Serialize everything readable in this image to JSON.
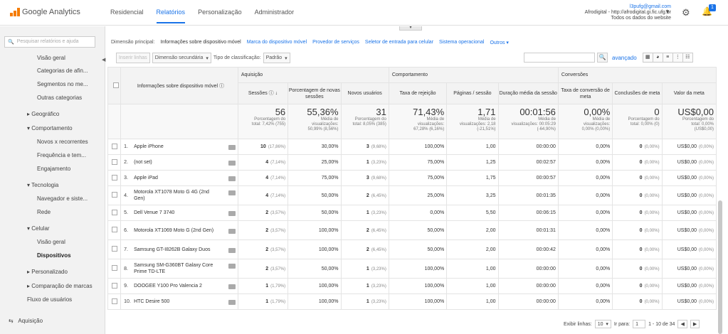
{
  "header": {
    "logo_text": "Google Analytics",
    "nav": [
      "Residencial",
      "Relatórios",
      "Personalização",
      "Administrador"
    ],
    "account_email": "l3pufg@gmail.com",
    "account_site": "Afrodigital - http://afrodigital.gi.fic.ufg.br",
    "account_view": "Todos os dados do website",
    "notification_count": "1"
  },
  "sidebar": {
    "search_placeholder": "Pesquisar relatórios e ajuda",
    "items": [
      "Visão geral",
      "Categorias de afin...",
      "Segmentos no me...",
      "Outras categorias",
      "Geográfico",
      "Comportamento",
      "Novos x recorrentes",
      "Frequência e tem...",
      "Engajamento",
      "Tecnologia",
      "Navegador e siste...",
      "Rede",
      "Celular",
      "Visão geral",
      "Dispositivos",
      "Personalizado",
      "Comparação de marcas",
      "Fluxo de usuários",
      "Aquisição"
    ]
  },
  "dimensions": {
    "label": "Dimensão principal:",
    "current": "Informações sobre dispositivo móvel",
    "links": [
      "Marca do dispositivo móvel",
      "Provedor de serviços",
      "Seletor de entrada para celular",
      "Sistema operacional",
      "Outros"
    ]
  },
  "controls": {
    "plot": "Inserir linhas",
    "secondary": "Dimensão secundária",
    "sort_label": "Tipo de classificação:",
    "sort_value": "Padrão",
    "advanced": "avançado"
  },
  "table": {
    "groups": [
      "Aquisição",
      "Comportamento",
      "Conversões"
    ],
    "dim_header": "Informações sobre dispositivo móvel",
    "columns": [
      "Sessões",
      "Porcentagem de novas sessões",
      "Novos usuários",
      "Taxa de rejeição",
      "Páginas / sessão",
      "Duração média da sessão",
      "Taxa de conversão de meta",
      "Conclusões de meta",
      "Valor da meta"
    ],
    "totals": [
      {
        "v": "56",
        "s1": "Porcentagem do",
        "s2": "total: 7,42% (755)",
        "s3": ""
      },
      {
        "v": "55,36%",
        "s1": "Média de",
        "s2": "visualizações:",
        "s3": "50,99% (8,56%)"
      },
      {
        "v": "31",
        "s1": "Porcentagem do",
        "s2": "total: 8,05% (385)",
        "s3": ""
      },
      {
        "v": "71,43%",
        "s1": "Média de",
        "s2": "visualizações:",
        "s3": "67,28% (6,16%)"
      },
      {
        "v": "1,71",
        "s1": "Média de",
        "s2": "visualizações: 2,18",
        "s3": "(-21,51%)"
      },
      {
        "v": "00:01:56",
        "s1": "Média de",
        "s2": "visualizações: 00:05:29",
        "s3": "(-64,90%)"
      },
      {
        "v": "0,00%",
        "s1": "Média de",
        "s2": "visualizações:",
        "s3": "0,00% (0,00%)"
      },
      {
        "v": "0",
        "s1": "Porcentagem do",
        "s2": "total: 0,00% (0)",
        "s3": ""
      },
      {
        "v": "US$0,00",
        "s1": "Porcentagem do",
        "s2": "total: 0,00%",
        "s3": "(US$0,00)"
      }
    ],
    "rows": [
      {
        "i": "1.",
        "name": "Apple iPhone",
        "s": "10",
        "sp": "(17,86%)",
        "ns": "30,00%",
        "nu": "3",
        "nup": "(9,68%)",
        "tr": "100,00%",
        "ps": "1,00",
        "d": "00:00:00",
        "tc": "0,00%",
        "cm": "0",
        "cmp": "(0,00%)",
        "vm": "US$0,00",
        "vmp": "(0,00%)"
      },
      {
        "i": "2.",
        "name": "(not set)",
        "s": "4",
        "sp": "(7,14%)",
        "ns": "25,00%",
        "nu": "1",
        "nup": "(3,23%)",
        "tr": "75,00%",
        "ps": "1,25",
        "d": "00:02:57",
        "tc": "0,00%",
        "cm": "0",
        "cmp": "(0,00%)",
        "vm": "US$0,00",
        "vmp": "(0,00%)"
      },
      {
        "i": "3.",
        "name": "Apple iPad",
        "s": "4",
        "sp": "(7,14%)",
        "ns": "75,00%",
        "nu": "3",
        "nup": "(9,68%)",
        "tr": "75,00%",
        "ps": "1,75",
        "d": "00:00:57",
        "tc": "0,00%",
        "cm": "0",
        "cmp": "(0,00%)",
        "vm": "US$0,00",
        "vmp": "(0,00%)"
      },
      {
        "i": "4.",
        "name": "Motorola XT1078 Moto G 4G (2nd Gen)",
        "s": "4",
        "sp": "(7,14%)",
        "ns": "50,00%",
        "nu": "2",
        "nup": "(6,45%)",
        "tr": "25,00%",
        "ps": "3,25",
        "d": "00:01:35",
        "tc": "0,00%",
        "cm": "0",
        "cmp": "(0,00%)",
        "vm": "US$0,00",
        "vmp": "(0,00%)"
      },
      {
        "i": "5.",
        "name": "Dell Venue 7 3740",
        "s": "2",
        "sp": "(3,57%)",
        "ns": "50,00%",
        "nu": "1",
        "nup": "(3,23%)",
        "tr": "0,00%",
        "ps": "5,50",
        "d": "00:06:15",
        "tc": "0,00%",
        "cm": "0",
        "cmp": "(0,00%)",
        "vm": "US$0,00",
        "vmp": "(0,00%)"
      },
      {
        "i": "6.",
        "name": "Motorola XT1069 Moto G (2nd Gen)",
        "s": "2",
        "sp": "(3,57%)",
        "ns": "100,00%",
        "nu": "2",
        "nup": "(6,45%)",
        "tr": "50,00%",
        "ps": "2,00",
        "d": "00:01:31",
        "tc": "0,00%",
        "cm": "0",
        "cmp": "(0,00%)",
        "vm": "US$0,00",
        "vmp": "(0,00%)"
      },
      {
        "i": "7.",
        "name": "Samsung GT-I8262B Galaxy Duos",
        "s": "2",
        "sp": "(3,57%)",
        "ns": "100,00%",
        "nu": "2",
        "nup": "(6,45%)",
        "tr": "50,00%",
        "ps": "2,00",
        "d": "00:00:42",
        "tc": "0,00%",
        "cm": "0",
        "cmp": "(0,00%)",
        "vm": "US$0,00",
        "vmp": "(0,00%)"
      },
      {
        "i": "8.",
        "name": "Samsung SM-G360BT Galaxy Core Prime TD-LTE",
        "s": "2",
        "sp": "(3,57%)",
        "ns": "50,00%",
        "nu": "1",
        "nup": "(3,23%)",
        "tr": "100,00%",
        "ps": "1,00",
        "d": "00:00:00",
        "tc": "0,00%",
        "cm": "0",
        "cmp": "(0,00%)",
        "vm": "US$0,00",
        "vmp": "(0,00%)"
      },
      {
        "i": "9.",
        "name": "DOOGEE Y100 Pro Valencia 2",
        "s": "1",
        "sp": "(1,79%)",
        "ns": "100,00%",
        "nu": "1",
        "nup": "(3,23%)",
        "tr": "100,00%",
        "ps": "1,00",
        "d": "00:00:00",
        "tc": "0,00%",
        "cm": "0",
        "cmp": "(0,00%)",
        "vm": "US$0,00",
        "vmp": "(0,00%)"
      },
      {
        "i": "10.",
        "name": "HTC Desire 500",
        "s": "1",
        "sp": "(1,79%)",
        "ns": "100,00%",
        "nu": "1",
        "nup": "(3,23%)",
        "tr": "100,00%",
        "ps": "1,00",
        "d": "00:00:00",
        "tc": "0,00%",
        "cm": "0",
        "cmp": "(0,00%)",
        "vm": "US$0,00",
        "vmp": "(0,00%)"
      }
    ]
  },
  "footer": {
    "show_rows": "Exibir linhas:",
    "rows_value": "10",
    "goto": "Ir para:",
    "goto_value": "1",
    "range": "1 - 10 de 34"
  }
}
